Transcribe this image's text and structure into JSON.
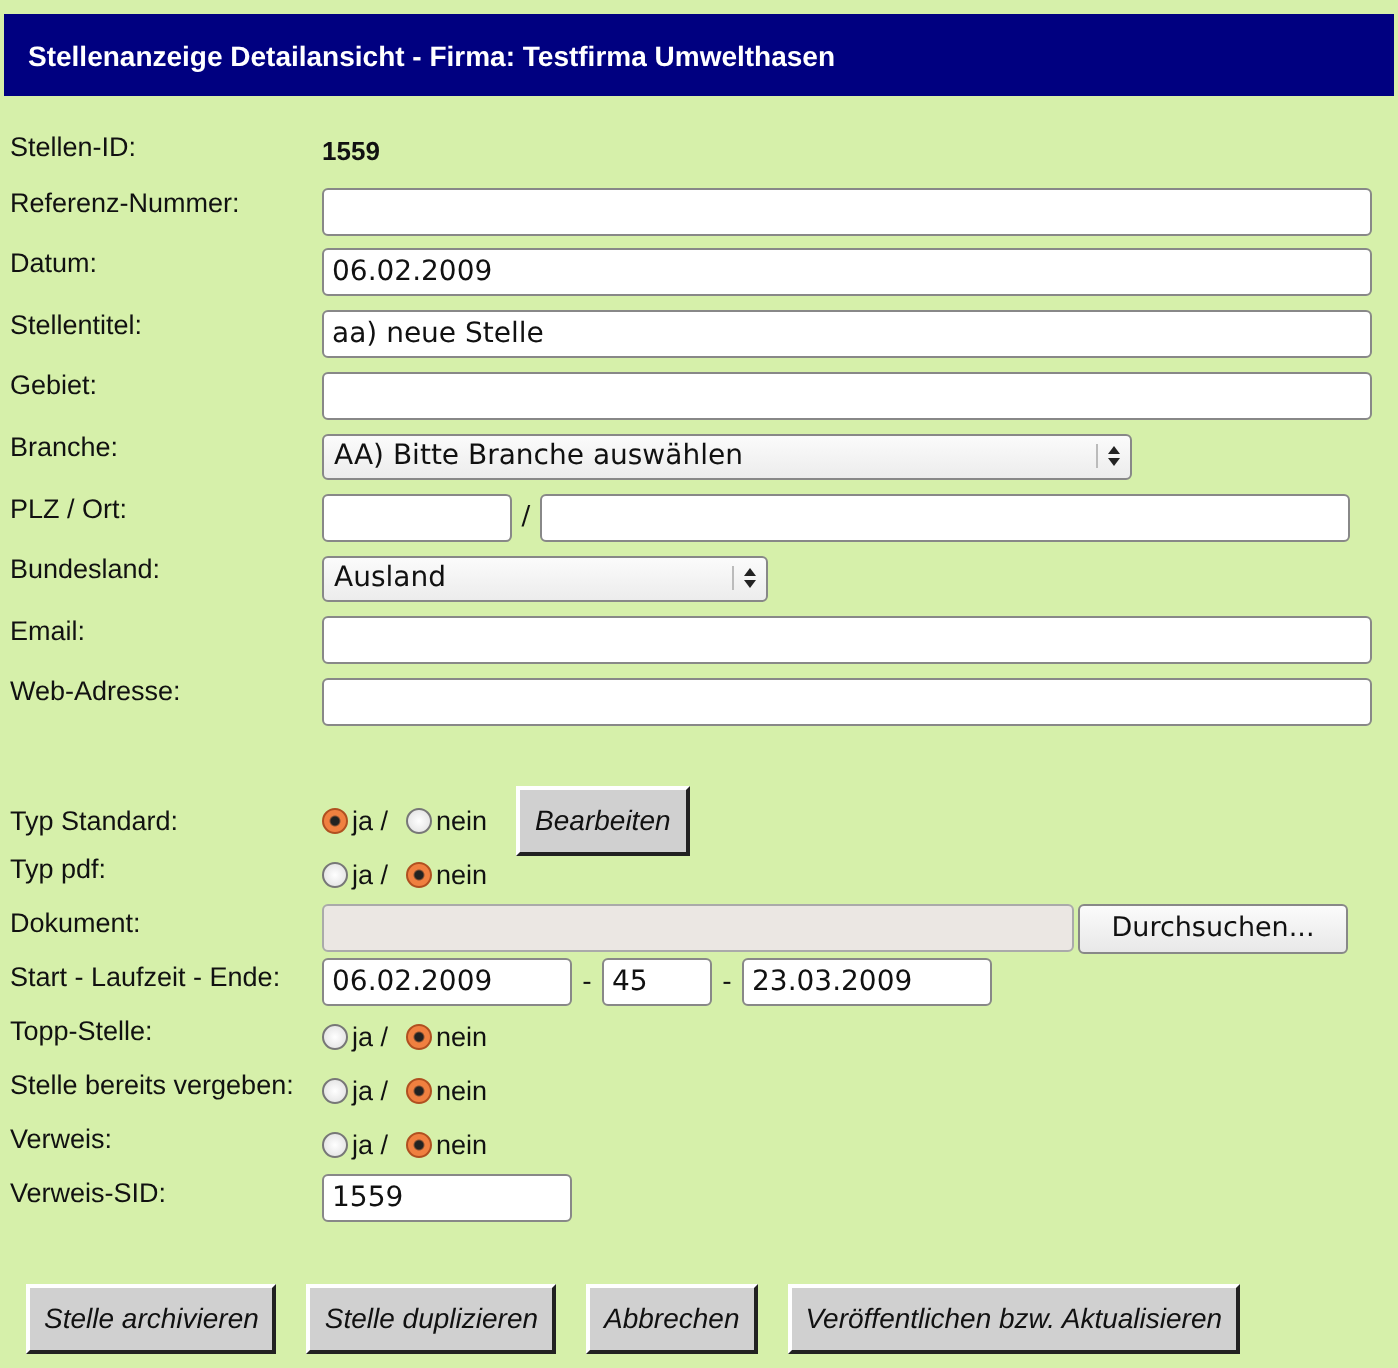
{
  "header": {
    "title": "Stellenanzeige Detailansicht - Firma: Testfirma Umwelthasen"
  },
  "fields": [
    {
      "label": "Stellen-ID:",
      "kind": "static",
      "value": "1559"
    },
    {
      "label": "Referenz-Nummer:",
      "kind": "input"
    },
    {
      "label": "Datum:",
      "kind": "input",
      "value": "06.02.2009"
    },
    {
      "label": "Stellentitel:",
      "kind": "input",
      "value": "aa) neue Stelle"
    },
    {
      "label": "Gebiet:",
      "kind": "input"
    },
    {
      "label": "Branche:",
      "kind": "select",
      "value": "AA) Bitte Branche auswählen"
    },
    {
      "label": "PLZ / Ort:",
      "kind": "pair",
      "separator": "/"
    },
    {
      "label": "Bundesland:",
      "kind": "select",
      "value": "Ausland"
    },
    {
      "label": "Email:",
      "kind": "input"
    },
    {
      "label": "Web-Adresse:",
      "kind": "input"
    }
  ],
  "options": [
    {
      "label": "Typ Standard:",
      "kind": "radio",
      "choices": [
        {
          "label": "ja /",
          "selected": true
        },
        {
          "label": "nein",
          "selected": false
        }
      ],
      "button": "Bearbeiten"
    },
    {
      "label": "Typ pdf:",
      "kind": "radio",
      "choices": [
        {
          "label": "ja /",
          "selected": false
        },
        {
          "label": "nein",
          "selected": true
        }
      ]
    },
    {
      "label": "Dokument:",
      "kind": "file",
      "button": "Durchsuchen...",
      "disabled": true
    },
    {
      "label": "Start - Laufzeit - Ende:",
      "kind": "range",
      "values": [
        "06.02.2009",
        "45",
        "23.03.2009"
      ],
      "separators": [
        "-",
        "-"
      ]
    },
    {
      "label": "Topp-Stelle:",
      "kind": "radio",
      "choices": [
        {
          "label": "ja /",
          "selected": false
        },
        {
          "label": "nein",
          "selected": true
        }
      ]
    },
    {
      "label": "Stelle bereits vergeben:",
      "kind": "radio",
      "choices": [
        {
          "label": "ja /",
          "selected": false
        },
        {
          "label": "nein",
          "selected": true
        }
      ]
    },
    {
      "label": "Verweis:",
      "kind": "radio",
      "choices": [
        {
          "label": "ja /",
          "selected": false
        },
        {
          "label": "nein",
          "selected": true
        }
      ]
    },
    {
      "label": "Verweis-SID:",
      "kind": "short",
      "value": "1559"
    }
  ],
  "buttons": [
    "Stelle archivieren",
    "Stelle duplizieren",
    "Abbrechen",
    "Veröffentlichen bzw. Aktualisieren"
  ]
}
